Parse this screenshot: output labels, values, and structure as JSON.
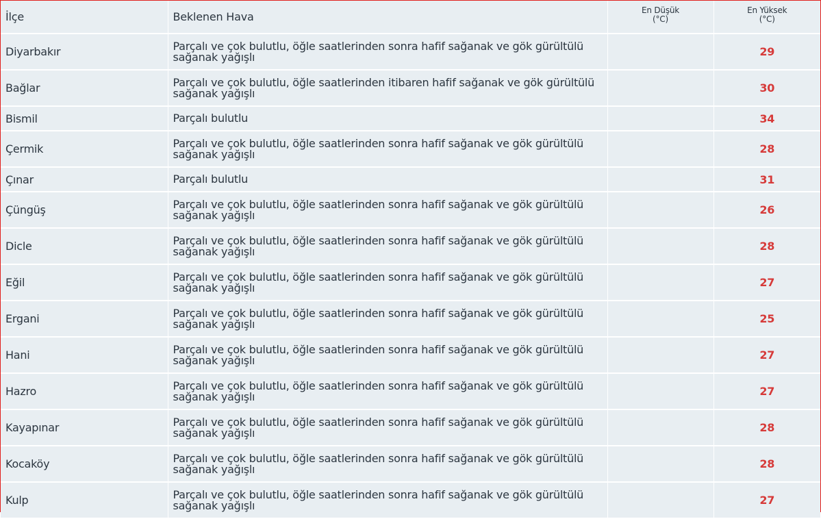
{
  "table": {
    "headers": {
      "district": "İlçe",
      "weather": "Beklenen Hava",
      "min_line1": "En Düşük",
      "min_line2": "(°C)",
      "max_line1": "En Yüksek",
      "max_line2": "(°C)"
    },
    "rows": [
      {
        "district": "Diyarbakır",
        "weather": "Parçalı ve çok bulutlu, öğle saatlerinden sonra hafif sağanak ve gök gürültülü sağanak yağışlı",
        "min": "",
        "max": "29"
      },
      {
        "district": "Bağlar",
        "weather": "Parçalı ve çok bulutlu, öğle saatlerinden itibaren hafif sağanak ve gök gürültülü sağanak yağışlı",
        "min": "",
        "max": "30"
      },
      {
        "district": "Bismil",
        "weather": "Parçalı bulutlu",
        "min": "",
        "max": "34"
      },
      {
        "district": "Çermik",
        "weather": "Parçalı ve çok bulutlu, öğle saatlerinden sonra hafif sağanak ve gök gürültülü sağanak yağışlı",
        "min": "",
        "max": "28"
      },
      {
        "district": "Çınar",
        "weather": "Parçalı bulutlu",
        "min": "",
        "max": "31"
      },
      {
        "district": "Çüngüş",
        "weather": "Parçalı ve çok bulutlu, öğle saatlerinden sonra hafif sağanak ve gök gürültülü sağanak yağışlı",
        "min": "",
        "max": "26"
      },
      {
        "district": "Dicle",
        "weather": "Parçalı ve çok bulutlu, öğle saatlerinden sonra hafif sağanak ve gök gürültülü sağanak yağışlı",
        "min": "",
        "max": "28"
      },
      {
        "district": "Eğil",
        "weather": "Parçalı ve çok bulutlu, öğle saatlerinden sonra hafif sağanak ve gök gürültülü sağanak yağışlı",
        "min": "",
        "max": "27"
      },
      {
        "district": "Ergani",
        "weather": "Parçalı ve çok bulutlu, öğle saatlerinden sonra hafif sağanak ve gök gürültülü sağanak yağışlı",
        "min": "",
        "max": "25"
      },
      {
        "district": "Hani",
        "weather": "Parçalı ve çok bulutlu, öğle saatlerinden sonra hafif sağanak ve gök gürültülü sağanak yağışlı",
        "min": "",
        "max": "27"
      },
      {
        "district": "Hazro",
        "weather": "Parçalı ve çok bulutlu, öğle saatlerinden sonra hafif sağanak ve gök gürültülü sağanak yağışlı",
        "min": "",
        "max": "27"
      },
      {
        "district": "Kayapınar",
        "weather": "Parçalı ve çok bulutlu, öğle saatlerinden sonra hafif sağanak ve gök gürültülü sağanak yağışlı",
        "min": "",
        "max": "28"
      },
      {
        "district": "Kocaköy",
        "weather": "Parçalı ve çok bulutlu, öğle saatlerinden sonra hafif sağanak ve gök gürültülü sağanak yağışlı",
        "min": "",
        "max": "28"
      },
      {
        "district": "Kulp",
        "weather": "Parçalı ve çok bulutlu, öğle saatlerinden sonra hafif sağanak ve gök gürültülü sağanak yağışlı",
        "min": "",
        "max": "27"
      }
    ]
  },
  "colors": {
    "border_accent": "#e0201d",
    "row_background": "#e8eef2",
    "max_temperature": "#d63a39",
    "text": "#2c3640"
  }
}
